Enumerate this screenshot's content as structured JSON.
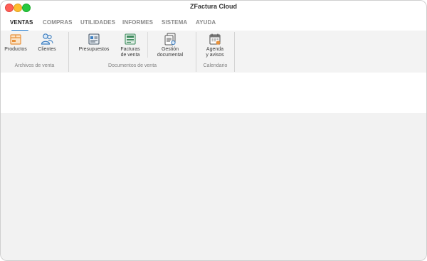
{
  "window": {
    "title": "ZFactura Cloud"
  },
  "tabs": [
    {
      "label": "VENTAS",
      "active": true
    },
    {
      "label": "COMPRAS"
    },
    {
      "label": "UTILIDADES"
    },
    {
      "label": "INFORMES"
    },
    {
      "label": "SISTEMA"
    },
    {
      "label": "AYUDA"
    }
  ],
  "groups": {
    "archivos": {
      "label": "Archivos de venta",
      "items": [
        {
          "label": "Productos",
          "icon": "box-icon"
        },
        {
          "label": "Clientes",
          "icon": "users-icon"
        }
      ]
    },
    "documentos": {
      "label": "Documentos de venta",
      "items": [
        {
          "label": "Presupuestos",
          "icon": "quote-icon"
        },
        {
          "label1": "Facturas",
          "label2": "de venta",
          "icon": "invoice-icon"
        },
        {
          "label1": "Gestión",
          "label2": "documental",
          "icon": "documents-icon"
        }
      ]
    },
    "calendario": {
      "label": "Calendario",
      "items": [
        {
          "label1": "Agenda",
          "label2": "y avisos",
          "icon": "calendar-icon"
        }
      ]
    }
  },
  "colors": {
    "accent": "#1f7ad0",
    "icon_orange": "#e8913a",
    "icon_blue": "#3d7fc1",
    "icon_green": "#3c8a5c"
  }
}
